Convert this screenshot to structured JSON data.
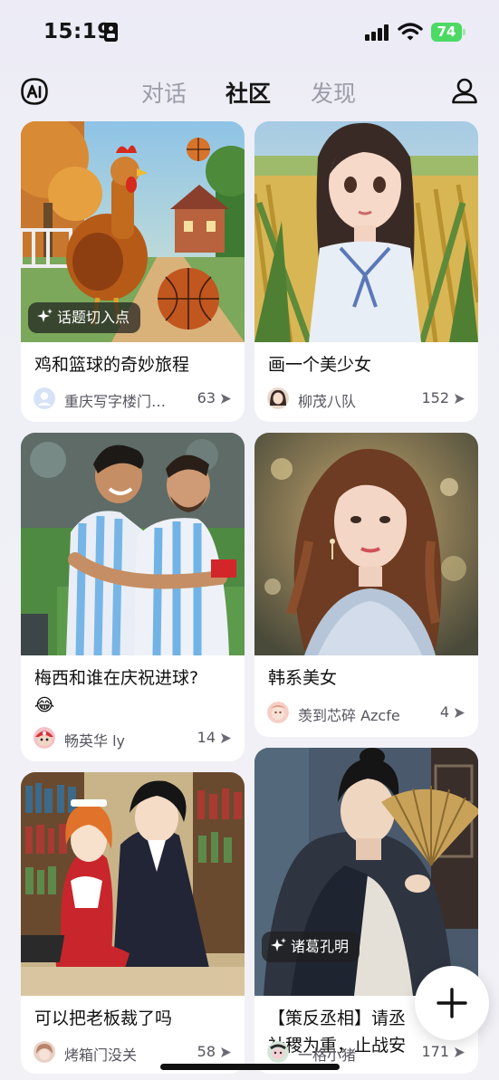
{
  "status_bar": {
    "time": "15:19",
    "battery": "74"
  },
  "header": {
    "tabs": [
      {
        "label": "对话"
      },
      {
        "label": "社区"
      },
      {
        "label": "发现"
      }
    ],
    "active_tab": "社区"
  },
  "cards": [
    {
      "image": "rooster-basketball-cartoon",
      "tag": "话题切入点",
      "title": "鸡和篮球的奇妙旅程",
      "author": "重庆写字楼门…",
      "count": "63"
    },
    {
      "image": "girl-in-wheat-field",
      "title": "画一个美少女",
      "author": "柳茂八队",
      "count": "152"
    },
    {
      "image": "messi-celebration-photo",
      "title": "梅西和谁在庆祝进球?\n😂",
      "author": "畅英华 ly",
      "count": "14"
    },
    {
      "image": "korean-woman-portrait",
      "title": "韩系美女",
      "author": "羡到芯碎 Azcfe",
      "count": "4"
    },
    {
      "image": "anime-maid-and-boss",
      "title": "可以把老板裁了吗",
      "author": "烤箱门没关",
      "count": "58"
    },
    {
      "image": "zhuge-liang-with-fan",
      "tag": "诸葛孔明",
      "title": "【策反丞相】请丞\n社稷为重，止战安",
      "author": "一格小猪",
      "count": "171"
    }
  ],
  "icons": {
    "ai_logo": "ai-logo-icon",
    "profile": "user-icon",
    "share": "share-arrow-icon",
    "sparkle": "sparkle-icon",
    "create": "plus-icon"
  }
}
